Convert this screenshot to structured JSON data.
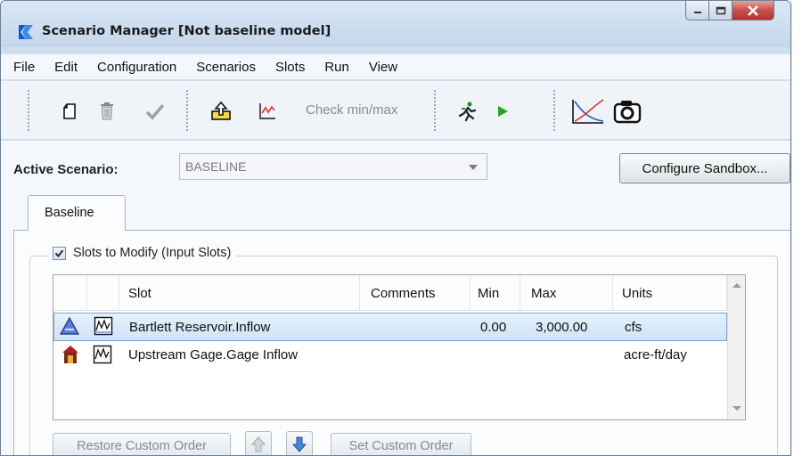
{
  "window": {
    "title": "Scenario Manager [Not baseline model]"
  },
  "menu": {
    "items": [
      "File",
      "Edit",
      "Configuration",
      "Scenarios",
      "Slots",
      "Run",
      "View"
    ]
  },
  "toolbar": {
    "check_minmax_label": "Check min/max",
    "icons": [
      "new-icon",
      "delete-icon",
      "checkmark-icon",
      "export-icon",
      "chart-icon",
      "runner-icon",
      "play-icon",
      "plot-icon",
      "camera-icon"
    ]
  },
  "active_scenario": {
    "label": "Active Scenario:",
    "value": "BASELINE"
  },
  "configure_sandbox_label": "Configure Sandbox...",
  "tab": {
    "label": "Baseline"
  },
  "slots_group": {
    "label": "Slots to Modify (Input Slots)",
    "checked": true
  },
  "table": {
    "columns": [
      "Slot",
      "Comments",
      "Min",
      "Max",
      "Units"
    ],
    "rows": [
      {
        "slot": "Bartlett Reservoir.Inflow",
        "comments": "",
        "min": "0.00",
        "max": "3,000.00",
        "units": "cfs",
        "selected": true
      },
      {
        "slot": "Upstream Gage.Gage Inflow",
        "comments": "",
        "min": "",
        "max": "",
        "units": "acre-ft/day",
        "selected": false
      }
    ]
  },
  "buttons": {
    "restore_custom_order": "Restore Custom Order",
    "set_custom_order": "Set Custom Order"
  },
  "colors": {
    "titlebar": "#c3d6eb",
    "selection": "#cfe3f7",
    "close_button": "#c75050",
    "play_green": "#1fa81f"
  }
}
